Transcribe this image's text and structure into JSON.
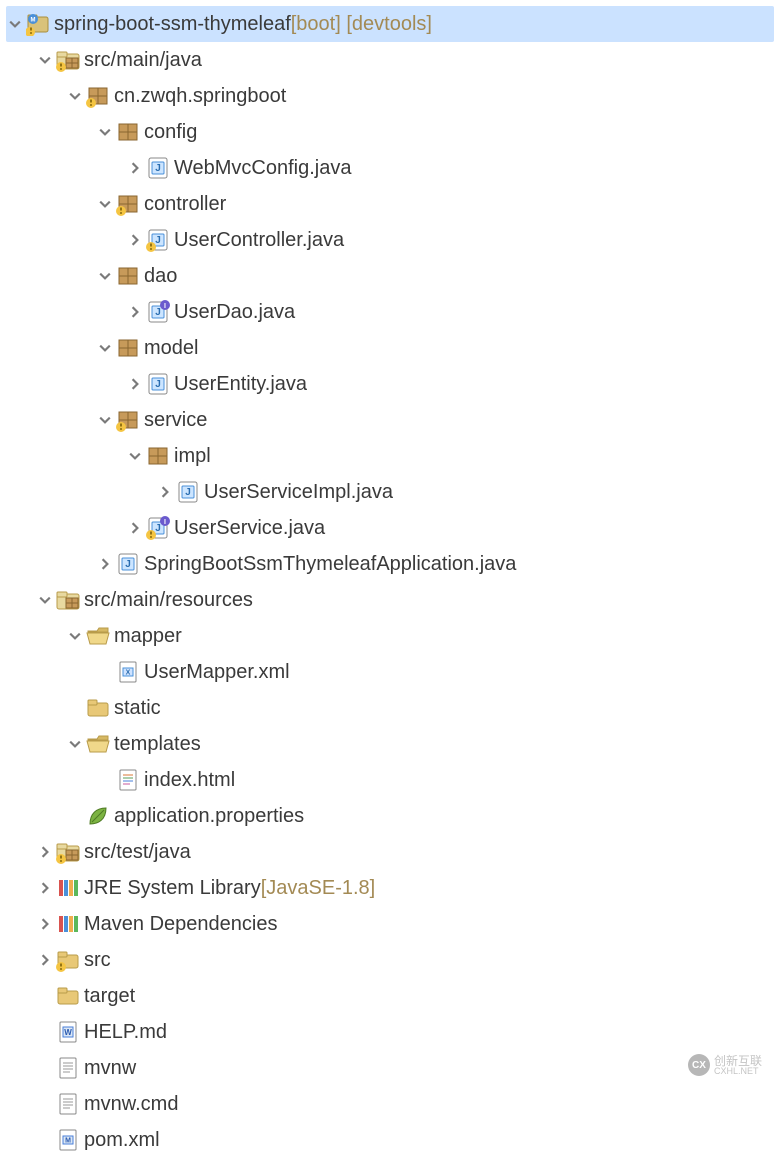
{
  "project": {
    "name": "spring-boot-ssm-thymeleaf",
    "annotation": " [boot] [devtools]"
  },
  "tree": [
    {
      "id": "src-main-java",
      "indent": 1,
      "arrow": "open",
      "icon": "package-folder-warn",
      "label": "src/main/java"
    },
    {
      "id": "pkg-root",
      "indent": 2,
      "arrow": "open",
      "icon": "package-warn",
      "label": "cn.zwqh.springboot"
    },
    {
      "id": "pkg-config",
      "indent": 3,
      "arrow": "open",
      "icon": "package",
      "label": "config"
    },
    {
      "id": "file-webmvc",
      "indent": 4,
      "arrow": "closed",
      "icon": "java",
      "label": "WebMvcConfig.java"
    },
    {
      "id": "pkg-controller",
      "indent": 3,
      "arrow": "open",
      "icon": "package-warn",
      "label": "controller"
    },
    {
      "id": "file-usercontroller",
      "indent": 4,
      "arrow": "closed",
      "icon": "java-warn",
      "label": "UserController.java"
    },
    {
      "id": "pkg-dao",
      "indent": 3,
      "arrow": "open",
      "icon": "package",
      "label": "dao"
    },
    {
      "id": "file-userdao",
      "indent": 4,
      "arrow": "closed",
      "icon": "java-interface",
      "label": "UserDao.java"
    },
    {
      "id": "pkg-model",
      "indent": 3,
      "arrow": "open",
      "icon": "package",
      "label": "model"
    },
    {
      "id": "file-userentity",
      "indent": 4,
      "arrow": "closed",
      "icon": "java",
      "label": "UserEntity.java"
    },
    {
      "id": "pkg-service",
      "indent": 3,
      "arrow": "open",
      "icon": "package-warn",
      "label": "service"
    },
    {
      "id": "pkg-impl",
      "indent": 4,
      "arrow": "open",
      "icon": "package",
      "label": "impl"
    },
    {
      "id": "file-userserviceimpl",
      "indent": 5,
      "arrow": "closed",
      "icon": "java",
      "label": "UserServiceImpl.java"
    },
    {
      "id": "file-userservice",
      "indent": 4,
      "arrow": "closed",
      "icon": "java-interface-warn",
      "label": "UserService.java"
    },
    {
      "id": "file-springbootapp",
      "indent": 3,
      "arrow": "closed",
      "icon": "java",
      "label": "SpringBootSsmThymeleafApplication.java"
    },
    {
      "id": "src-main-resources",
      "indent": 1,
      "arrow": "open",
      "icon": "package-folder",
      "label": "src/main/resources"
    },
    {
      "id": "folder-mapper",
      "indent": 2,
      "arrow": "open",
      "icon": "folder-open",
      "label": "mapper"
    },
    {
      "id": "file-usermapper",
      "indent": 3,
      "arrow": "none",
      "icon": "xml",
      "label": "UserMapper.xml"
    },
    {
      "id": "folder-static",
      "indent": 2,
      "arrow": "none",
      "icon": "folder",
      "label": "static"
    },
    {
      "id": "folder-templates",
      "indent": 2,
      "arrow": "open",
      "icon": "folder-open",
      "label": "templates"
    },
    {
      "id": "file-index",
      "indent": 3,
      "arrow": "none",
      "icon": "html",
      "label": "index.html"
    },
    {
      "id": "file-appprops",
      "indent": 2,
      "arrow": "none",
      "icon": "leaf",
      "label": "application.properties"
    },
    {
      "id": "src-test-java",
      "indent": 1,
      "arrow": "closed",
      "icon": "package-folder-warn",
      "label": "src/test/java"
    },
    {
      "id": "jre",
      "indent": 1,
      "arrow": "closed",
      "icon": "library",
      "label": "JRE System Library",
      "annot": " [JavaSE-1.8]"
    },
    {
      "id": "maven",
      "indent": 1,
      "arrow": "closed",
      "icon": "library",
      "label": "Maven Dependencies"
    },
    {
      "id": "folder-src",
      "indent": 1,
      "arrow": "closed",
      "icon": "folder-warn",
      "label": "src"
    },
    {
      "id": "folder-target",
      "indent": 1,
      "arrow": "none",
      "icon": "folder",
      "label": "target"
    },
    {
      "id": "file-help",
      "indent": 1,
      "arrow": "none",
      "icon": "word",
      "label": "HELP.md"
    },
    {
      "id": "file-mvnw",
      "indent": 1,
      "arrow": "none",
      "icon": "text",
      "label": "mvnw"
    },
    {
      "id": "file-mvnwcmd",
      "indent": 1,
      "arrow": "none",
      "icon": "text",
      "label": "mvnw.cmd"
    },
    {
      "id": "file-pom",
      "indent": 1,
      "arrow": "none",
      "icon": "maven",
      "label": "pom.xml"
    }
  ],
  "watermark": {
    "badge": "CX",
    "line1": "创新互联",
    "line2": "CXHL.NET"
  }
}
